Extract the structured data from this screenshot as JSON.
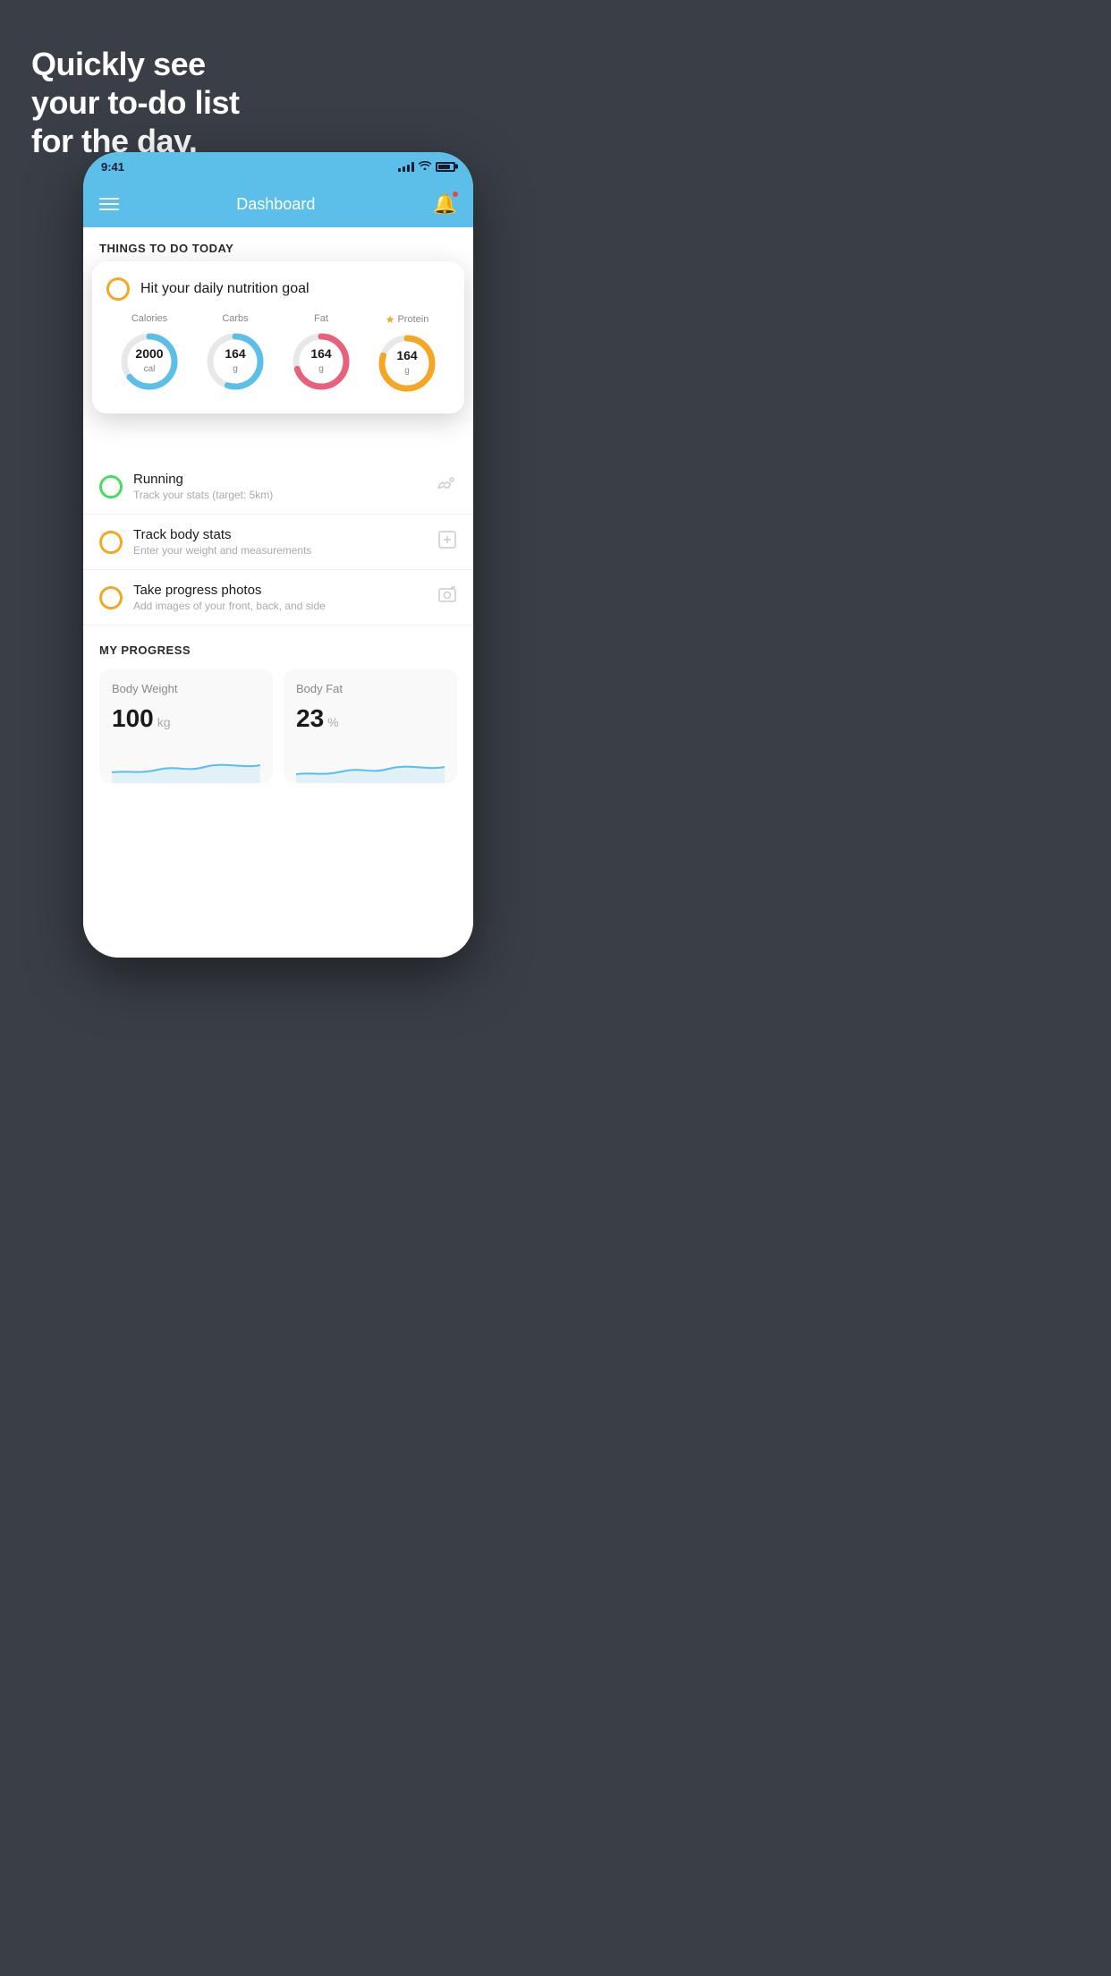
{
  "headline": {
    "line1": "Quickly see",
    "line2": "your to-do list",
    "line3": "for the day."
  },
  "phone": {
    "status": {
      "time": "9:41"
    },
    "nav": {
      "title": "Dashboard"
    },
    "sections": {
      "todo_header": "THINGS TO DO TODAY",
      "progress_header": "MY PROGRESS"
    },
    "floating_card": {
      "item_label": "Hit your daily nutrition goal",
      "macros": [
        {
          "label": "Calories",
          "value": "2000",
          "unit": "cal",
          "color": "#5bbfea",
          "pct": 65
        },
        {
          "label": "Carbs",
          "value": "164",
          "unit": "g",
          "color": "#5bbfea",
          "pct": 55
        },
        {
          "label": "Fat",
          "value": "164",
          "unit": "g",
          "color": "#e8607a",
          "pct": 70
        },
        {
          "label": "Protein",
          "value": "164",
          "unit": "g",
          "color": "#f5a623",
          "pct": 80,
          "star": true
        }
      ]
    },
    "list_items": [
      {
        "title": "Running",
        "subtitle": "Track your stats (target: 5km)",
        "icon": "👟",
        "checked": true,
        "check_color": "green"
      },
      {
        "title": "Track body stats",
        "subtitle": "Enter your weight and measurements",
        "icon": "⊡",
        "checked": false,
        "check_color": "yellow"
      },
      {
        "title": "Take progress photos",
        "subtitle": "Add images of your front, back, and side",
        "icon": "👤",
        "checked": false,
        "check_color": "yellow"
      }
    ],
    "progress": [
      {
        "title": "Body Weight",
        "value": "100",
        "unit": "kg"
      },
      {
        "title": "Body Fat",
        "value": "23",
        "unit": "%"
      }
    ]
  }
}
